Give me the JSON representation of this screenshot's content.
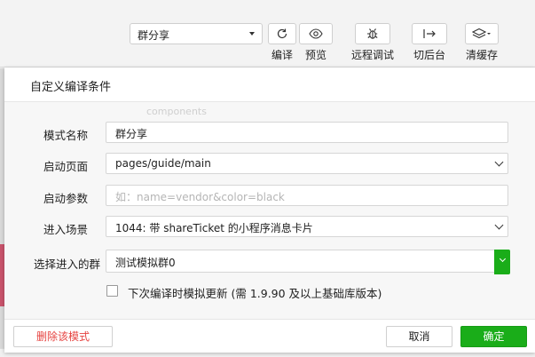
{
  "toolbar": {
    "mode_select_value": "群分享",
    "compile_label": "编译",
    "preview_label": "预览",
    "remote_debug_label": "远程调试",
    "background_label": "切后台",
    "clear_cache_label": "清缓存"
  },
  "dialog": {
    "title": "自定义编译条件",
    "fields": {
      "mode_name_label": "模式名称",
      "mode_name_value": "群分享",
      "start_page_label": "启动页面",
      "start_page_value": "pages/guide/main",
      "start_params_label": "启动参数",
      "start_params_placeholder": "如：name=vendor&color=black",
      "scene_label": "进入场景",
      "scene_value": "1044: 带 shareTicket 的小程序消息卡片",
      "group_label": "选择进入的群",
      "group_value": "测试模拟群0"
    },
    "checkbox_label": "下次编译时模拟更新 (需 1.9.90 及以上基础库版本)",
    "checkbox_checked": false,
    "delete_label": "删除该模式",
    "cancel_label": "取消",
    "confirm_label": "确定"
  },
  "background": {
    "ghost_text": "components"
  },
  "colors": {
    "accent_green": "#1aad19",
    "danger_red": "#e64340"
  }
}
